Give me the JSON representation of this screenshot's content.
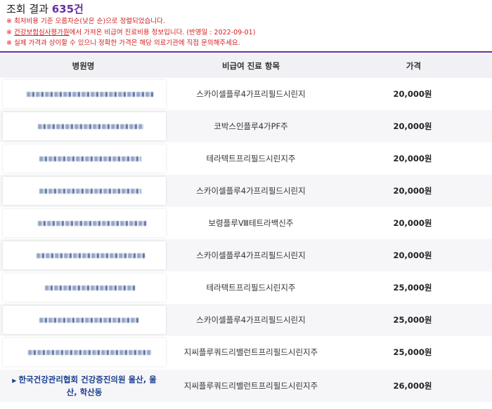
{
  "header": {
    "title_prefix": "조회 결과 ",
    "count": "635건",
    "notes": [
      "※ 최저비용 기준 오름차순(낮은 순)으로 정렬되었습니다.",
      "※ ",
      "건강보험심사평가원",
      "에서 가져온 비급여 진료비용 정보입니다. (반영일 : 2022-09-01)",
      "※ 실제 가격과 상이할 수 있으니 정확한 가격은 해당 의료기관에 직접 문의해주세요."
    ]
  },
  "table": {
    "columns": [
      "병원명",
      "비급여 진료 항목",
      "가격"
    ],
    "rows": [
      {
        "item": "스카이셀플루4가프리필드시린지",
        "price": "20,000원"
      },
      {
        "item": "코박스인플루4가PF주",
        "price": "20,000원"
      },
      {
        "item": "테라텍트프리필드시린지주",
        "price": "20,000원"
      },
      {
        "item": "스카이셀플루4가프리필드시린지",
        "price": "20,000원"
      },
      {
        "item": "보령플루Ⅷ테트라백신주",
        "price": "20,000원"
      },
      {
        "item": "스카이셀플루4가프리필드시린지",
        "price": "20,000원"
      },
      {
        "item": "테라텍트프리필드시린지주",
        "price": "25,000원"
      },
      {
        "item": "스카이셀플루4가프리필드시린지",
        "price": "25,000원"
      },
      {
        "item": "지씨플루쿼드리밸런트프리필드시린지주",
        "price": "25,000원"
      },
      {
        "hospital_line1": "한국건강관리협회 건강증진의원 울산, 울",
        "hospital_line2": "산, 학산동",
        "item": "지씨플루쿼드리밸런트프리필드시린지주",
        "price": "26,000원"
      }
    ]
  },
  "icons": {
    "row_arrow": "triangle-right-icon"
  },
  "colors": {
    "accent": "#6a2ea0",
    "notice": "#d61b1b",
    "link": "#1b3f8f"
  }
}
